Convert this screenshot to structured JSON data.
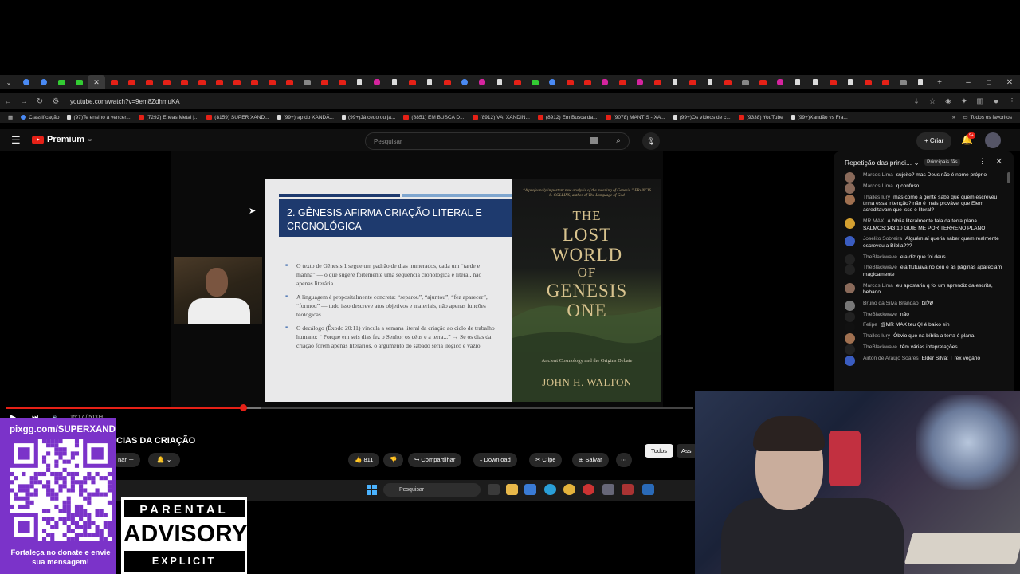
{
  "browser": {
    "url": "youtube.com/watch?v=9em8ZdhmuKA",
    "bookmarks": [
      {
        "label": "Classificação",
        "icon": "globe-icon"
      },
      {
        "label": "(97)Te ensino a vencer...",
        "icon": "tiktok-icon"
      },
      {
        "label": "(7292) Enéas Metal |...",
        "icon": "youtube-icon"
      },
      {
        "label": "(8159) SUPER XAND...",
        "icon": "youtube-icon"
      },
      {
        "label": "(99+)rap do XANDÃ...",
        "icon": "tiktok-icon"
      },
      {
        "label": "(99+)Já cedo ou já...",
        "icon": "tiktok-icon"
      },
      {
        "label": "(8851) EM BUSCA D...",
        "icon": "youtube-icon"
      },
      {
        "label": "(8912) VAI XANDIN...",
        "icon": "youtube-icon"
      },
      {
        "label": "(8912) Em Busca da...",
        "icon": "youtube-icon"
      },
      {
        "label": "(9078) MANTIS - XA...",
        "icon": "youtube-icon"
      },
      {
        "label": "(99+)Os vídeos de c...",
        "icon": "tiktok-icon"
      },
      {
        "label": "(9338) YouTube",
        "icon": "youtube-icon"
      },
      {
        "label": "(99+)Xandão vs Fra...",
        "icon": "tiktok-icon"
      }
    ],
    "all_bookmarks_label": "Todos os favoritos"
  },
  "youtube": {
    "logo_label": "Premium",
    "logo_badge": "BR",
    "search_placeholder": "Pesquisar",
    "create_label": "+ Criar",
    "notifications_badge": "9+"
  },
  "slide": {
    "title": "2. GÊNESIS AFIRMA CRIAÇÃO LITERAL E CRONOLÓGICA",
    "bullets": [
      "O texto de Gênesis 1 segue um padrão de dias numerados, cada um “tarde e manhã” — o que sugere fortemente uma sequência cronológica e literal, não apenas literária.",
      "A linguagem é propositalmente concreta: “separou”, “ajuntou”, “fez aparecer”, “formou” — tudo isso descreve atos objetivos e materiais, não apenas funções teológicas.",
      "O decálogo (Êxodo 20:11) vincula a semana literal da criação ao ciclo de trabalho humano: “ Porque em seis dias fez o Senhor os céus e a terra...” → Se os dias da criação forem apenas literários, o argumento do sábado seria ilógico e vazio."
    ],
    "accent_color": "#1e3a6e"
  },
  "book": {
    "blurb": "“A profoundly important new analysis of the meaning of Genesis.” FRANCIS S. COLLINS, author of The Language of God",
    "title_lines": [
      "THE",
      "LOST",
      "WORLD",
      "OF",
      "GENESIS",
      "ONE"
    ],
    "subtitle": "Ancient Cosmology and the Origins Debate",
    "author": "JOHN H. WALTON"
  },
  "player": {
    "progress": 0.345,
    "buffered": 0.37,
    "time": "15:17 / 51:09"
  },
  "video": {
    "title_partial": "CIAS DA CRIAÇÃO",
    "subscribe_label": "nar",
    "likes": "811",
    "share_label": "Compartilhar",
    "download_label": "Download",
    "clip_label": "Clipe",
    "save_label": "Salvar",
    "chip_all": "Todos",
    "chip_2": "Assi"
  },
  "taskbar": {
    "search_label": "Pesquisar"
  },
  "chat": {
    "header": "Repetição das princi...",
    "fans_label": "Principais fãs",
    "messages": [
      {
        "author": "Marcos Lima",
        "text": "sujeito? mas Deus não é nome próprio",
        "avatar_color": "#8a6a5a"
      },
      {
        "author": "Marcos Lima",
        "text": "q confuso",
        "avatar_color": "#8a6a5a"
      },
      {
        "author": "Thalles Iury",
        "text": "mas como a gente sabe que quem escreveu tinha essa intenção? não é mais provável que Elem acreditavam que isso é literal?",
        "avatar_color": "#a07050"
      },
      {
        "author": "MR MAX",
        "text": "A bíblia literalmente fala da terra plana SALMOS:143:10 GUIE ME POR TERRENO PLANO",
        "avatar_color": "#d4a030"
      },
      {
        "author": "Joselito Sobreira",
        "text": "Alguém aí queria saber quem realmente escreveu a Bíblia???",
        "avatar_color": "#3a5cc0"
      },
      {
        "author": "TheBlackwave",
        "text": "ela diz que foi deus",
        "avatar_color": "#222222"
      },
      {
        "author": "TheBlackwave",
        "text": "ela flutuava no céu e as páginas apareciam magicamente",
        "avatar_color": "#222222"
      },
      {
        "author": "Marcos Lima",
        "text": "eu apostaria q foi um aprendiz da escrita, bebado",
        "avatar_color": "#8a6a5a"
      },
      {
        "author": "Bruno da Silva Brandão",
        "text": "שלום",
        "avatar_color": "#777777"
      },
      {
        "author": "TheBlackwave",
        "text": "não",
        "avatar_color": "#222222"
      },
      {
        "author": "Felipe",
        "text": "@MR MAX teu QI é baixo ein",
        "avatar_color": "#111111"
      },
      {
        "author": "Thalles Iury",
        "text": "Óbvio que na bíblia a terra é plana.",
        "avatar_color": "#a07050"
      },
      {
        "author": "TheBlackwave",
        "text": "têm várias intepretações",
        "avatar_color": "#222222"
      },
      {
        "author": "Airton de Araújo Soares",
        "text": "Elder Silva: T rex vegano",
        "avatar_color": "#3a5cc0"
      }
    ]
  },
  "overlay": {
    "qr_url": "pixgg.com/SUPERXAND",
    "qr_text": "Fortaleça no donate e envie sua mensagem!",
    "advisory_top": "PARENTAL",
    "advisory_mid": "ADVISORY",
    "advisory_bottom": "EXPLICIT CONTENT"
  }
}
